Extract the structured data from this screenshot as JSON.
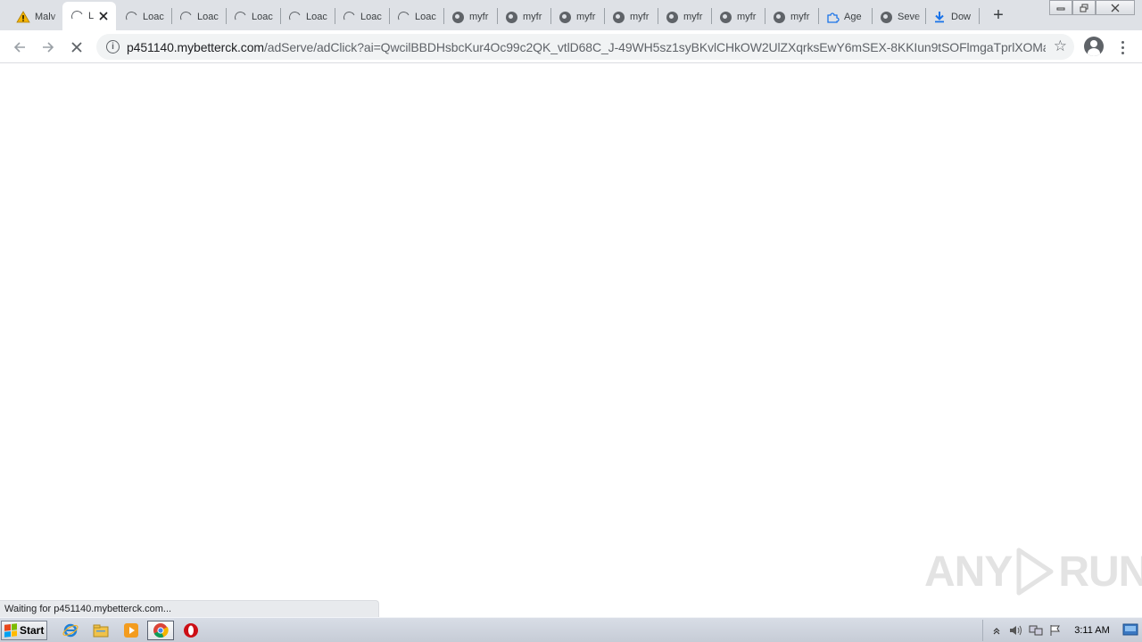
{
  "tabs": [
    {
      "title": "Malv",
      "icon": "warning-icon"
    },
    {
      "title": "L",
      "icon": "spinner-icon",
      "active": true
    },
    {
      "title": "Loac",
      "icon": "spinner-icon"
    },
    {
      "title": "Loac",
      "icon": "spinner-icon"
    },
    {
      "title": "Loac",
      "icon": "spinner-icon"
    },
    {
      "title": "Loac",
      "icon": "spinner-icon"
    },
    {
      "title": "Loac",
      "icon": "spinner-icon"
    },
    {
      "title": "Loac",
      "icon": "spinner-icon"
    },
    {
      "title": "myfr",
      "icon": "globe-icon"
    },
    {
      "title": "myfr",
      "icon": "globe-icon"
    },
    {
      "title": "myfr",
      "icon": "globe-icon"
    },
    {
      "title": "myfr",
      "icon": "globe-icon"
    },
    {
      "title": "myfr",
      "icon": "globe-icon"
    },
    {
      "title": "myfr",
      "icon": "globe-icon"
    },
    {
      "title": "myfr",
      "icon": "globe-icon"
    },
    {
      "title": "Age",
      "icon": "puzzle-icon"
    },
    {
      "title": "Seve",
      "icon": "globe-icon"
    },
    {
      "title": "Dow",
      "icon": "download-icon"
    }
  ],
  "toolbar": {
    "url_host": "p451140.mybetterck.com",
    "url_rest": "/adServe/adClick?ai=QwcilBBDHsbcKur4Oc99c2QK_vtlD68C_J-49WH5sz1syBKvlCHkOW2UlZXqrksEwY6mSEX-8KKIun9tSOFlmgaTprlXOMa..."
  },
  "status": {
    "text": "Waiting for p451140.mybetterck.com..."
  },
  "watermark": {
    "left": "ANY",
    "right": "RUN"
  },
  "taskbar": {
    "start_label": "Start",
    "clock": "3:11 AM",
    "apps": [
      "ie-icon",
      "explorer-icon",
      "media-player-icon",
      "chrome-icon",
      "opera-icon"
    ]
  },
  "colors": {
    "tabstrip": "#dee1e6",
    "omnibox": "#f1f3f4",
    "accent_blue": "#1a73e8",
    "opera_red": "#cc0f16"
  }
}
